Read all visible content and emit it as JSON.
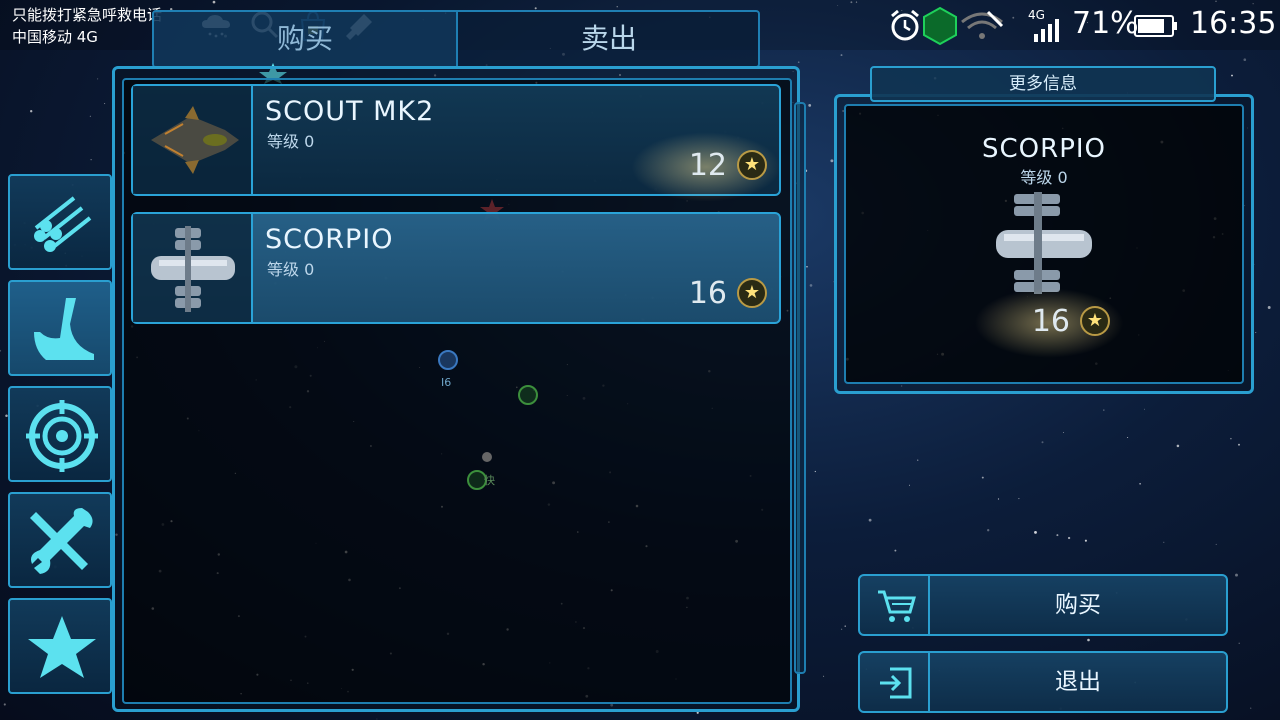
{
  "status_bar": {
    "emergency_text": "只能拨打紧急呼救电话",
    "carrier": "中国移动 4G",
    "network_badge": "4G",
    "battery": "71%",
    "time": "16:35",
    "icons": [
      "cloud-rain-icon",
      "search-icon",
      "bag-icon",
      "cleaner-icon",
      "alarm-icon",
      "wifi-icon",
      "signal-icon",
      "battery-icon"
    ]
  },
  "tabs": {
    "buy": "购买",
    "sell": "卖出",
    "selected": "buy"
  },
  "side_nav": {
    "items": [
      "materials-icon",
      "ship-hull-icon",
      "target-icon",
      "tools-icon",
      "star-icon"
    ],
    "selected": "ship-hull-icon"
  },
  "ships": [
    {
      "name": "SCOUT MK2",
      "level_label": "等级 0",
      "price": "12",
      "thumbnail": "scout-ship"
    },
    {
      "name": "SCORPIO",
      "level_label": "等级 0",
      "price": "16",
      "thumbnail": "scorpio-ship"
    }
  ],
  "selected_ship_index": 1,
  "map_background": {
    "labels": [
      "I6",
      "快"
    ]
  },
  "info_panel": {
    "header": "更多信息",
    "name": "SCORPIO",
    "level_label": "等级 0",
    "price": "16"
  },
  "actions": {
    "buy_label": "购买",
    "exit_label": "退出"
  },
  "colors": {
    "panel_border": "#2a9fd0",
    "accent_cyan": "#5ce1ef",
    "coin_gold": "#ffe27a"
  }
}
